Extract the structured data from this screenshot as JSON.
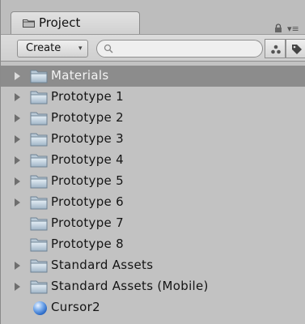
{
  "panel": {
    "tab_label": "Project",
    "tab_icon": "folder-icon",
    "lock_icon": "lock-icon",
    "menu_icon": "≡"
  },
  "toolbar": {
    "create_label": "Create",
    "create_arrow": "▾",
    "search_value": "",
    "search_placeholder": "",
    "filter_by_type_icon": "filter-type-icon",
    "filter_by_label_icon": "tag-icon"
  },
  "items": [
    {
      "label": "Materials",
      "expandable": true,
      "selected": true,
      "icon": "folder-icon"
    },
    {
      "label": "Prototype 1",
      "expandable": true,
      "selected": false,
      "icon": "folder-icon"
    },
    {
      "label": "Prototype 2",
      "expandable": true,
      "selected": false,
      "icon": "folder-icon"
    },
    {
      "label": "Prototype 3",
      "expandable": true,
      "selected": false,
      "icon": "folder-icon"
    },
    {
      "label": "Prototype 4",
      "expandable": true,
      "selected": false,
      "icon": "folder-icon"
    },
    {
      "label": "Prototype 5",
      "expandable": true,
      "selected": false,
      "icon": "folder-icon"
    },
    {
      "label": "Prototype 6",
      "expandable": true,
      "selected": false,
      "icon": "folder-icon"
    },
    {
      "label": "Prototype 7",
      "expandable": false,
      "selected": false,
      "icon": "folder-icon"
    },
    {
      "label": "Prototype 8",
      "expandable": false,
      "selected": false,
      "icon": "folder-icon"
    },
    {
      "label": "Standard Assets",
      "expandable": true,
      "selected": false,
      "icon": "folder-icon"
    },
    {
      "label": "Standard Assets (Mobile)",
      "expandable": true,
      "selected": false,
      "icon": "folder-icon"
    },
    {
      "label": "Cursor2",
      "expandable": false,
      "selected": false,
      "icon": "sphere-icon"
    }
  ],
  "colors": {
    "selected_row": "#8c8c8c",
    "panel_bg": "#c2c2c2"
  }
}
